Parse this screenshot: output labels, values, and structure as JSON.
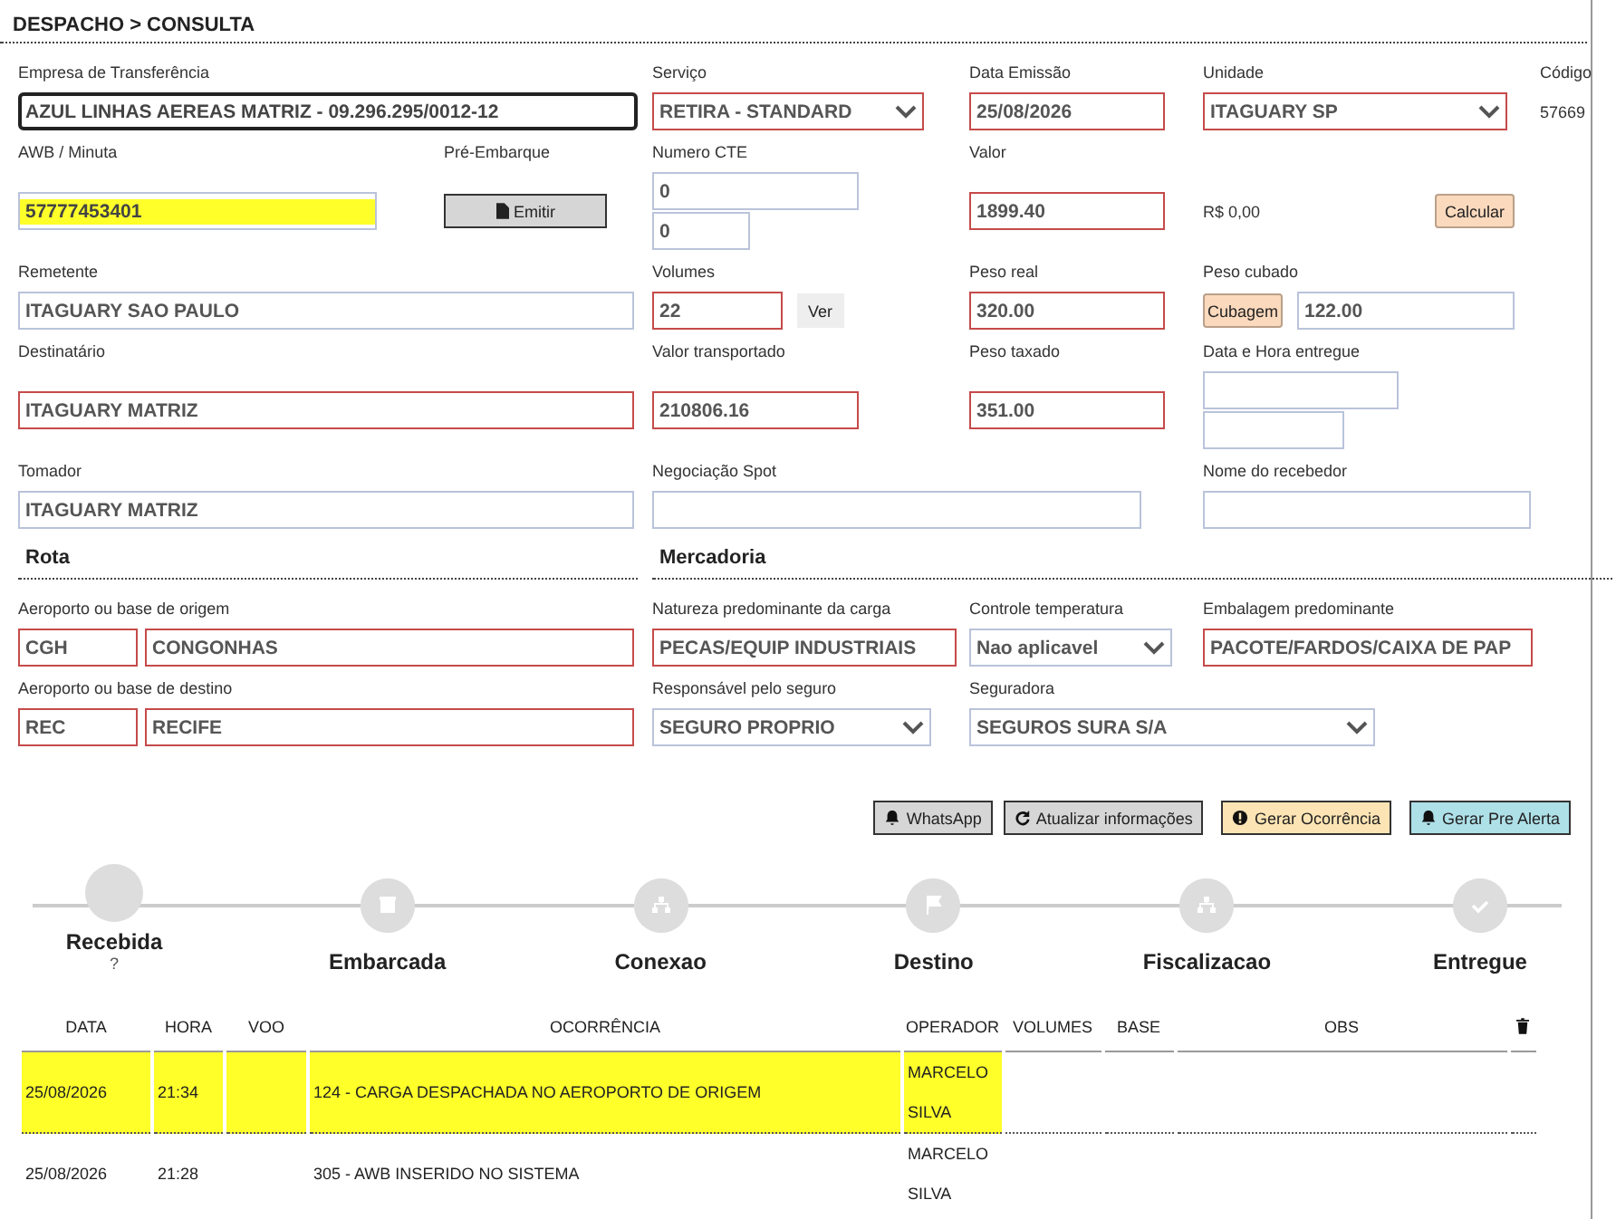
{
  "title": "DESPACHO > CONSULTA",
  "form": {
    "rows": [
      {
        "cells": [
          {
            "label": "Empresa de Transferência",
            "controls": [
              {
                "kind": "input",
                "value": "AZUL LINHAS AEREAS MATRIZ - 09.296.295/0012-12",
                "error": false,
                "focused": true,
                "highlighted": false
              }
            ]
          },
          {
            "label": "Serviço",
            "controls": [
              {
                "kind": "select",
                "value": "RETIRA - STANDARD",
                "error": true,
                "focused": false,
                "highlighted": false
              }
            ]
          },
          {
            "label": "Data Emissão",
            "controls": [
              {
                "kind": "input",
                "value": "25/08/2026",
                "error": true,
                "focused": false,
                "highlighted": false
              }
            ]
          },
          {
            "label": "Unidade",
            "controls": [
              {
                "kind": "select",
                "value": "ITAGUARY SP",
                "error": true,
                "focused": false,
                "highlighted": false
              }
            ]
          },
          {
            "label": "Código",
            "controls": [
              {
                "kind": "text",
                "value": "57669"
              }
            ]
          }
        ]
      },
      {
        "cells": [
          {
            "label": "AWB / Minuta",
            "controls": [
              {
                "kind": "input",
                "value": "57777453401",
                "error": false,
                "focused": false,
                "highlighted": true
              }
            ]
          },
          {
            "label": "Pré-Embarque",
            "controls": [
              {
                "kind": "button",
                "value": "Emitir"
              }
            ]
          },
          {
            "label": "Numero CTE",
            "controls": [
              {
                "kind": "input",
                "value": "0",
                "error": false,
                "focused": false,
                "highlighted": false
              },
              {
                "kind": "input",
                "value": "0",
                "error": false,
                "focused": false,
                "highlighted": false
              }
            ]
          },
          {
            "label": "Valor",
            "controls": [
              {
                "kind": "input",
                "value": "1899.40",
                "error": true,
                "focused": false,
                "highlighted": false
              }
            ]
          },
          {
            "controls": [
              {
                "kind": "text",
                "value": "R$ 0,00"
              },
              {
                "kind": "tinted",
                "value": "Calcular"
              }
            ]
          }
        ]
      },
      {
        "cells": [
          {
            "label": "Remetente",
            "controls": [
              {
                "kind": "input",
                "value": "ITAGUARY SAO PAULO",
                "error": false,
                "focused": false,
                "highlighted": false
              }
            ]
          },
          {
            "label": "Volumes",
            "controls": [
              {
                "kind": "input",
                "value": "22",
                "error": true,
                "focused": false,
                "highlighted": false
              },
              {
                "kind": "plain",
                "value": "Ver"
              }
            ]
          },
          {
            "label": "Peso real",
            "controls": [
              {
                "kind": "input",
                "value": "320.00",
                "error": true,
                "focused": false,
                "highlighted": false
              }
            ]
          },
          {
            "label": "Peso cubado",
            "controls": [
              {
                "kind": "tinted",
                "value": "Cubagem"
              },
              {
                "kind": "input",
                "value": "122.00",
                "error": false,
                "focused": false,
                "highlighted": false
              }
            ]
          }
        ]
      },
      {
        "cells": [
          {
            "label": "Destinatário",
            "controls": [
              {
                "kind": "input",
                "value": "ITAGUARY MATRIZ",
                "error": true,
                "focused": false,
                "highlighted": false
              }
            ]
          },
          {
            "label": "Valor transportado",
            "controls": [
              {
                "kind": "input",
                "value": "210806.16",
                "error": true,
                "focused": false,
                "highlighted": false
              }
            ]
          },
          {
            "label": "Peso taxado",
            "controls": [
              {
                "kind": "input",
                "value": "351.00",
                "error": true,
                "focused": false,
                "highlighted": false
              }
            ]
          },
          {
            "label": "Data e Hora entregue",
            "controls": [
              {
                "kind": "input",
                "error": false,
                "focused": false,
                "highlighted": false
              },
              {
                "kind": "input",
                "error": false,
                "focused": false,
                "highlighted": false
              }
            ]
          }
        ]
      },
      {
        "cells": [
          {
            "label": "Tomador",
            "controls": [
              {
                "kind": "input",
                "value": "ITAGUARY MATRIZ",
                "error": false,
                "focused": false,
                "highlighted": false
              }
            ]
          },
          {
            "label": "Negociação Spot",
            "controls": [
              {
                "kind": "input",
                "error": false,
                "focused": false,
                "highlighted": false
              }
            ]
          },
          {
            "label": "Nome do recebedor",
            "controls": [
              {
                "kind": "input",
                "error": false,
                "focused": false,
                "highlighted": false
              }
            ]
          }
        ]
      },
      {
        "sections": [
          "Rota",
          "Mercadoria"
        ]
      },
      {
        "cells": [
          {
            "label": "Aeroporto ou base de origem",
            "controls": [
              {
                "kind": "input",
                "value": "CGH",
                "error": true,
                "focused": false,
                "highlighted": false
              },
              {
                "kind": "input",
                "value": "CONGONHAS",
                "error": true,
                "focused": false,
                "highlighted": false
              }
            ]
          },
          {
            "label": "Natureza predominante da carga",
            "controls": [
              {
                "kind": "input",
                "value": "PECAS/EQUIP INDUSTRIAIS",
                "error": true,
                "focused": false,
                "highlighted": false
              }
            ]
          },
          {
            "label": "Controle temperatura",
            "controls": [
              {
                "kind": "select",
                "value": "Nao aplicavel",
                "error": false,
                "focused": false,
                "highlighted": false
              }
            ]
          },
          {
            "label": "Embalagem predominante",
            "controls": [
              {
                "kind": "input",
                "value": "PACOTE/FARDOS/CAIXA DE PAP",
                "error": true,
                "focused": false,
                "highlighted": false
              }
            ]
          }
        ]
      },
      {
        "cells": [
          {
            "label": "Aeroporto ou base de destino",
            "controls": [
              {
                "kind": "input",
                "value": "REC",
                "error": true,
                "focused": false,
                "highlighted": false
              },
              {
                "kind": "input",
                "value": "RECIFE",
                "error": true,
                "focused": false,
                "highlighted": false
              }
            ]
          },
          {
            "label": "Responsável pelo seguro",
            "controls": [
              {
                "kind": "select",
                "value": "SEGURO PROPRIO",
                "error": false,
                "focused": false,
                "highlighted": false
              }
            ]
          },
          {
            "label": "Seguradora",
            "controls": [
              {
                "kind": "select",
                "value": "SEGUROS SURA S/A",
                "error": false,
                "focused": false,
                "highlighted": false
              }
            ]
          }
        ]
      }
    ]
  },
  "actions": [
    {
      "label": "WhatsApp",
      "kind": "default"
    },
    {
      "label": "Atualizar informações",
      "kind": "default"
    },
    {
      "label": "Gerar Ocorrência",
      "kind": "warning"
    },
    {
      "label": "Gerar Pre Alerta",
      "kind": "info"
    }
  ],
  "timeline": [
    {
      "label": "Recebida",
      "current": true,
      "note": "?"
    },
    {
      "label": "Embarcada",
      "current": false
    },
    {
      "label": "Conexao",
      "current": false
    },
    {
      "label": "Destino",
      "current": false
    },
    {
      "label": "Fiscalizacao",
      "current": false
    },
    {
      "label": "Entregue",
      "current": false
    }
  ],
  "table": {
    "columns": [
      "DATA",
      "HORA",
      "VOO",
      "OCORRÊNCIA",
      "OPERADOR",
      "VOLUMES",
      "BASE",
      "OBS"
    ],
    "rows": [
      {
        "data": "25/08/2026",
        "hora": "21:34",
        "ocorrencia": "124 - CARGA DESPACHADA NO AEROPORTO DE ORIGEM",
        "operador": "MARCELO SILVA",
        "highlighted": true
      },
      {
        "data": "25/08/2026",
        "hora": "21:28",
        "ocorrencia": "305 - AWB INSERIDO NO SISTEMA",
        "operador": "MARCELO SILVA",
        "highlighted": false
      }
    ]
  }
}
